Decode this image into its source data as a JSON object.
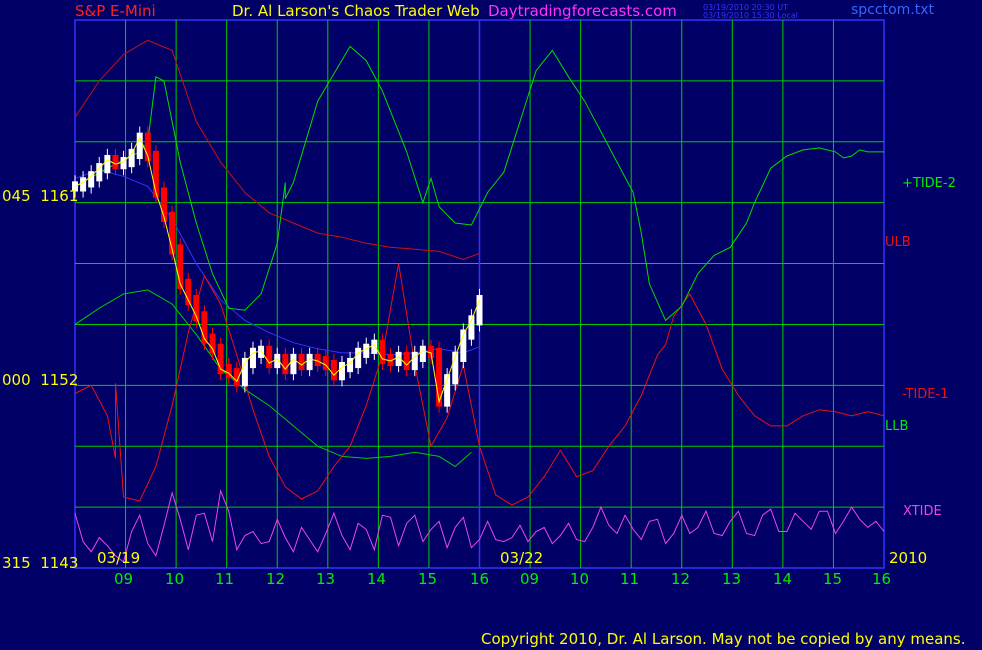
{
  "header": {
    "symbol": "S&P E-Mini",
    "title": "Dr. Al Larson's Chaos Trader Web",
    "site": "Daytradingforecasts.com",
    "timestamp_ut": "03/19/2010 20:30 UT",
    "timestamp_local": "03/19/2010 15:30 Local",
    "file": "spcctom.txt"
  },
  "footer": {
    "copyright": "Copyright 2010, Dr. Al Larson. May not be copied by any means."
  },
  "colors": {
    "background": "#000066",
    "grid": "#00cc00",
    "up_bar": "#ffffff",
    "down_bar": "#ff0000",
    "tide2": "#00dd00",
    "tide1": "#ee1111",
    "xtide": "#ee44ee",
    "band": "#cc1111",
    "llb": "#00cc00",
    "blue": "#3333ff",
    "yellow": "#ffff00"
  },
  "chart_data": {
    "type": "line",
    "title": "S&P E-Mini",
    "ylim": [
      1143,
      1170
    ],
    "y_ticks": [
      {
        "price": "1161",
        "prefix": "045"
      },
      {
        "price": "1152",
        "prefix": "000"
      },
      {
        "price": "1143",
        "prefix": "315"
      }
    ],
    "x_ticks": [
      "09",
      "10",
      "11",
      "12",
      "13",
      "14",
      "15",
      "16",
      "09",
      "10",
      "11",
      "12",
      "13",
      "14",
      "15",
      "16"
    ],
    "dates": [
      "03/19",
      "03/22",
      "2010"
    ],
    "grid": true,
    "series": [
      {
        "name": "+TIDE-2",
        "label": "+TIDE-2",
        "color": "#00dd00",
        "x": [
          0,
          4,
          8,
          9,
          10,
          11,
          13,
          15,
          17,
          19,
          21,
          23,
          25,
          26,
          26,
          27,
          30,
          34,
          36,
          38,
          41,
          43,
          44,
          45,
          47,
          49,
          51,
          53,
          55,
          57,
          59,
          61,
          63,
          65,
          67,
          69,
          70,
          71,
          73,
          75,
          77,
          79,
          81,
          83,
          84,
          86,
          88,
          90,
          92,
          94,
          95,
          96,
          97,
          98,
          100
        ],
        "y": [
          1161.8,
          1162.7,
          1163.5,
          1164.0,
          1167.2,
          1167.0,
          1163.0,
          1160.0,
          1157.5,
          1155.8,
          1155.7,
          1156.5,
          1159.0,
          1162.0,
          1161.2,
          1162.0,
          1166.0,
          1168.7,
          1168.0,
          1166.5,
          1163.5,
          1161.0,
          1162.2,
          1160.8,
          1160.0,
          1159.9,
          1161.5,
          1162.5,
          1165.0,
          1167.5,
          1168.5,
          1167.2,
          1166.0,
          1164.5,
          1163.0,
          1161.5,
          1159.5,
          1157.0,
          1155.2,
          1155.9,
          1157.5,
          1158.4,
          1158.8,
          1160.0,
          1161.0,
          1162.7,
          1163.3,
          1163.6,
          1163.7,
          1163.5,
          1163.2,
          1163.3,
          1163.6,
          1163.5,
          1163.5
        ]
      },
      {
        "name": "-TIDE-1",
        "label": "-TIDE-1",
        "color": "#ee1111",
        "x": [
          0,
          2,
          4,
          5,
          5,
          6,
          8,
          10,
          12,
          14,
          16,
          18,
          20,
          22,
          24,
          26,
          28,
          30,
          32,
          34,
          36,
          38,
          40,
          42,
          44,
          46,
          48,
          50,
          52,
          54,
          56,
          58,
          60,
          62,
          64,
          66,
          68,
          70,
          72,
          73,
          74,
          76,
          78,
          80,
          82,
          84,
          86,
          88,
          90,
          92,
          94,
          96,
          98,
          100
        ],
        "y": [
          1151.6,
          1152.0,
          1150.5,
          1148.4,
          1152.1,
          1146.5,
          1146.3,
          1148.0,
          1151.0,
          1154.6,
          1157.4,
          1156.0,
          1153.5,
          1150.8,
          1148.5,
          1147.0,
          1146.4,
          1146.8,
          1148.0,
          1149.0,
          1151.0,
          1153.5,
          1158.0,
          1153.0,
          1149.0,
          1150.4,
          1153.0,
          1149.0,
          1146.6,
          1146.1,
          1146.5,
          1147.5,
          1148.8,
          1147.5,
          1147.8,
          1149.0,
          1150.0,
          1151.5,
          1153.5,
          1154.0,
          1155.4,
          1156.5,
          1155.0,
          1152.8,
          1151.5,
          1150.5,
          1150.0,
          1150.0,
          1150.5,
          1150.8,
          1150.7,
          1150.5,
          1150.7,
          1150.5
        ]
      },
      {
        "name": "ULB",
        "label": "ULB",
        "color": "#cc1111",
        "x": [
          0,
          3,
          6,
          9,
          12,
          15,
          18,
          21,
          24,
          27,
          30,
          33,
          36,
          39,
          42,
          45,
          48,
          50
        ],
        "y": [
          1165.2,
          1167.0,
          1168.3,
          1169.0,
          1168.5,
          1165.0,
          1163.0,
          1161.5,
          1160.5,
          1160.0,
          1159.5,
          1159.3,
          1159.0,
          1158.8,
          1158.7,
          1158.6,
          1158.2,
          1158.5
        ]
      },
      {
        "name": "LLB",
        "label": "LLB",
        "color": "#00cc00",
        "x": [
          0,
          3,
          6,
          9,
          12,
          15,
          18,
          21,
          24,
          27,
          30,
          33,
          36,
          39,
          42,
          45,
          47,
          49
        ],
        "y": [
          1155.0,
          1155.8,
          1156.5,
          1156.7,
          1156.0,
          1154.5,
          1152.8,
          1151.8,
          1151.0,
          1150.0,
          1149.0,
          1148.5,
          1148.4,
          1148.5,
          1148.7,
          1148.5,
          1148.0,
          1148.7
        ]
      },
      {
        "name": "Blue average",
        "color": "#3333ff",
        "x": [
          0,
          3,
          6,
          9,
          12,
          15,
          18,
          21,
          24,
          27,
          30,
          33,
          36,
          39,
          42,
          45,
          48,
          50
        ],
        "y": [
          1162.2,
          1162.6,
          1162.3,
          1161.8,
          1160.2,
          1158.0,
          1156.2,
          1155.2,
          1154.6,
          1154.1,
          1153.8,
          1153.6,
          1153.6,
          1153.5,
          1153.6,
          1153.8,
          1153.6,
          1153.9
        ]
      },
      {
        "name": "Price",
        "color": "#ffffff",
        "x": [
          0,
          1,
          2,
          3,
          4,
          5,
          6,
          7,
          8,
          9,
          10,
          11,
          12,
          13,
          14,
          15,
          16,
          17,
          18,
          19,
          20,
          21,
          22,
          23,
          24,
          25,
          26,
          27,
          28,
          29,
          30,
          31,
          32,
          33,
          34,
          35,
          36,
          37,
          38,
          39,
          40,
          41,
          42,
          43,
          44,
          45,
          46,
          47,
          48,
          49,
          50
        ],
        "y": [
          1161.8,
          1162.0,
          1162.3,
          1162.7,
          1163.1,
          1162.9,
          1163.0,
          1163.4,
          1164.2,
          1163.3,
          1161.5,
          1160.3,
          1158.7,
          1157.0,
          1156.2,
          1155.4,
          1154.3,
          1153.8,
          1152.8,
          1152.6,
          1152.2,
          1153.1,
          1153.6,
          1153.7,
          1153.1,
          1153.3,
          1152.8,
          1153.3,
          1153.0,
          1153.3,
          1153.2,
          1153.0,
          1152.5,
          1152.9,
          1153.1,
          1153.6,
          1153.8,
          1154.0,
          1153.3,
          1153.2,
          1153.4,
          1153.0,
          1153.4,
          1153.7,
          1153.6,
          1151.2,
          1152.3,
          1153.4,
          1154.5,
          1155.2,
          1156.2
        ]
      },
      {
        "name": "XTIDE",
        "label": "XTIDE",
        "color": "#ee44ee",
        "x": [
          0,
          1,
          2,
          3,
          4,
          5,
          6,
          7,
          8,
          9,
          10,
          11,
          12,
          13,
          14,
          15,
          16,
          17,
          18,
          19,
          20,
          21,
          22,
          23,
          24,
          25,
          26,
          27,
          28,
          29,
          30,
          31,
          32,
          33,
          34,
          35,
          36,
          37,
          38,
          39,
          40,
          41,
          42,
          43,
          44,
          45,
          46,
          47,
          48,
          49,
          50,
          51,
          52,
          53,
          54,
          55,
          56,
          57,
          58,
          59,
          60,
          61,
          62,
          63,
          64,
          65,
          66,
          67,
          68,
          69,
          70,
          71,
          72,
          73,
          74,
          75,
          76,
          77,
          78,
          79,
          80,
          81,
          82,
          83,
          84,
          85,
          86,
          87,
          88,
          89,
          90,
          91,
          92,
          93,
          94,
          95,
          96,
          97,
          98,
          99,
          100
        ],
        "y": [
          1145.7,
          1144.3,
          1143.8,
          1144.5,
          1144.1,
          1143.6,
          1143.3,
          1144.8,
          1145.6,
          1144.2,
          1143.6,
          1145.1,
          1146.7,
          1145.4,
          1143.9,
          1145.6,
          1145.7,
          1144.3,
          1146.8,
          1145.8,
          1143.9,
          1144.6,
          1144.8,
          1144.2,
          1144.3,
          1145.4,
          1144.5,
          1143.8,
          1145.0,
          1144.4,
          1143.8,
          1144.7,
          1145.7,
          1144.6,
          1143.9,
          1145.2,
          1144.9,
          1143.9,
          1145.6,
          1145.5,
          1144.1,
          1145.2,
          1145.6,
          1144.3,
          1144.9,
          1145.3,
          1144.0,
          1145.0,
          1145.5,
          1144.0,
          1144.4,
          1145.3,
          1144.4,
          1144.3,
          1144.5,
          1145.1,
          1144.3,
          1144.8,
          1145.0,
          1144.2,
          1144.6,
          1145.2,
          1144.4,
          1144.3,
          1145.0,
          1146.0,
          1145.1,
          1144.7,
          1145.6,
          1144.9,
          1144.4,
          1145.3,
          1145.4,
          1144.2,
          1144.7,
          1145.6,
          1144.7,
          1145.0,
          1145.8,
          1144.7,
          1144.6,
          1145.3,
          1145.8,
          1144.7,
          1144.6,
          1145.6,
          1145.9,
          1144.8,
          1144.8,
          1145.7,
          1145.3,
          1144.9,
          1145.8,
          1145.8,
          1144.7,
          1145.3,
          1146.0,
          1145.4,
          1145.0,
          1145.3,
          1144.8
        ]
      }
    ]
  }
}
